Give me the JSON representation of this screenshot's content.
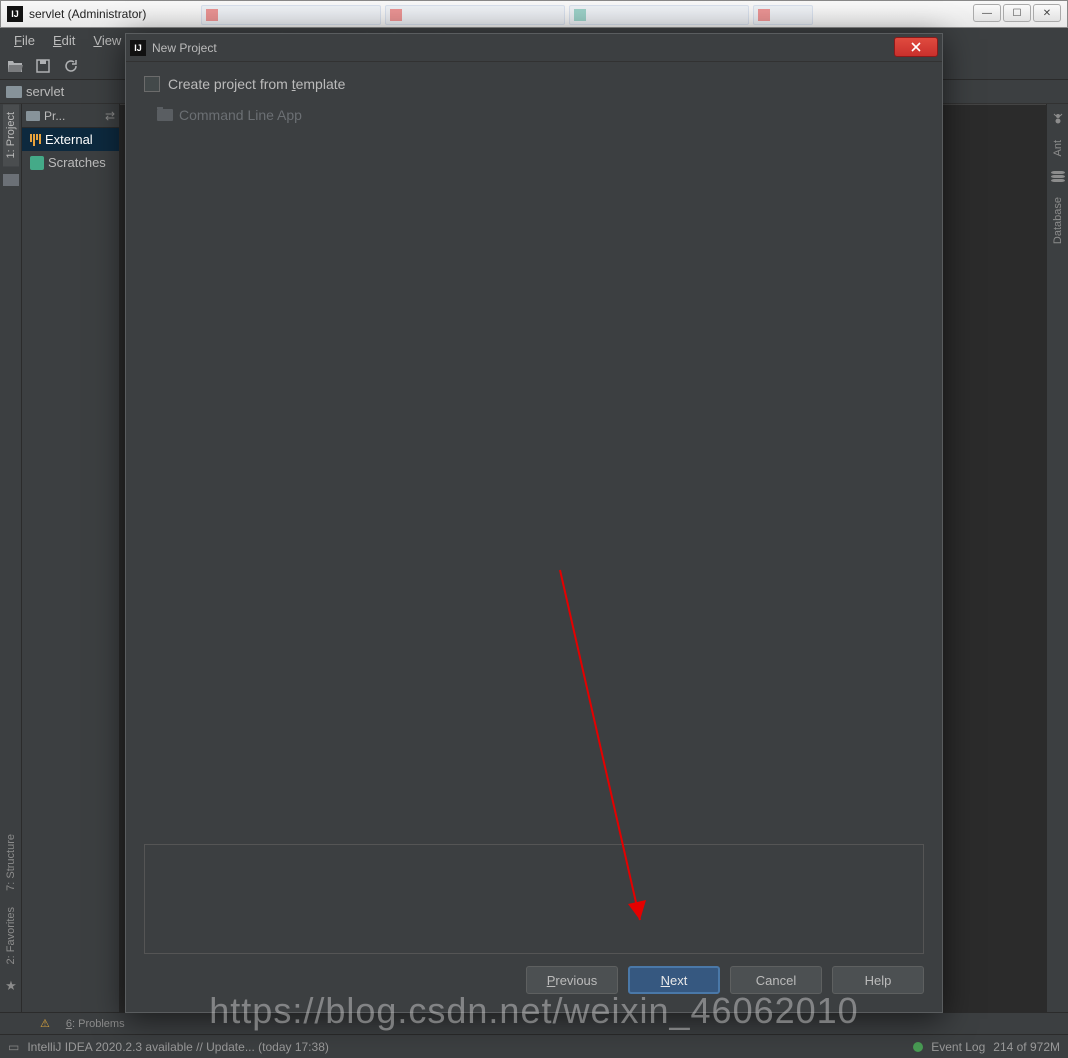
{
  "window": {
    "title": "servlet (Administrator)"
  },
  "menu": {
    "file": "File",
    "edit": "Edit",
    "view": "View"
  },
  "breadcrumb": {
    "root": "servlet"
  },
  "projectPanel": {
    "header": "Pr...",
    "items": [
      "External",
      "Scratches"
    ]
  },
  "rightGutter": {
    "ant": "Ant",
    "database": "Database"
  },
  "leftGutter": {
    "project": "1: Project",
    "structure": "7: Structure",
    "favorites": "2: Favorites"
  },
  "bottomTabs": {
    "problems": "6: Problems"
  },
  "statusBar": {
    "message": "IntelliJ IDEA 2020.2.3 available // Update... (today 17:38)",
    "eventLog": "Event Log",
    "memory": "214 of 972M"
  },
  "dialog": {
    "title": "New Project",
    "checkboxLabel": "Create project from template",
    "templates": [
      "Command Line App"
    ],
    "buttons": {
      "previous": "Previous",
      "next": "Next",
      "cancel": "Cancel",
      "help": "Help"
    }
  },
  "watermark": "https://blog.csdn.net/weixin_46062010"
}
